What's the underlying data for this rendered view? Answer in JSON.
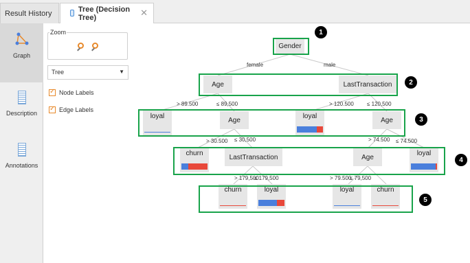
{
  "tabs": {
    "result_history": "Result History",
    "active_tab": "Tree (Decision Tree)",
    "close_glyph": "✕"
  },
  "sidebar": {
    "graph": "Graph",
    "description": "Description",
    "annotations": "Annotations"
  },
  "panel": {
    "zoom_title": "Zoom",
    "view_select": "Tree",
    "node_labels": "Node Labels",
    "edge_labels": "Edge Labels"
  },
  "tree": {
    "root": "Gender",
    "edge_female": "female",
    "edge_male": "male",
    "l1_age": "Age",
    "l1_lasttx": "LastTransaction",
    "e_gt_89500": "> 89.500",
    "e_le_89500": "≤ 89,500",
    "e_gt_120500": "> 120.500",
    "e_le_120500": "≤ 120,500",
    "l2_loyal_a": "loyal",
    "l2_age_a": "Age",
    "l2_loyal_b": "loyal",
    "l2_age_b": "Age",
    "e_gt_30500": "> 30.500",
    "e_le_30500": "≤ 30,500",
    "e_gt_74500": "> 74.500",
    "e_le_74500": "≤ 74.500",
    "l3_churn": "churn",
    "l3_lasttx": "LastTransaction",
    "l3_age": "Age",
    "l3_loyal": "loyal",
    "e_gt_179500": "> 179,500",
    "e_le_179500": "≤ 179,500",
    "e_gt_79500": "> 79.500",
    "e_le_79500": "≤ 79,500",
    "l4_churn_a": "churn",
    "l4_loyal_a": "loyal",
    "l4_loyal_b": "loyal",
    "l4_churn_b": "churn"
  },
  "badges": [
    "1",
    "2",
    "3",
    "4",
    "5"
  ],
  "colors": {
    "blue": "#4a7fdc",
    "red": "#e8483a",
    "highlight": "#18a34a",
    "accent": "#e8892a"
  },
  "leaf_distributions": {
    "l2_loyal_a": {
      "blue": 1.0,
      "red": 0.0,
      "thin": true
    },
    "l2_loyal_b": {
      "blue": 0.75,
      "red": 0.25,
      "thin": false
    },
    "l3_churn": {
      "blue": 0.25,
      "red": 0.75,
      "thin": false
    },
    "l3_loyal": {
      "blue": 0.95,
      "red": 0.05,
      "thin": false
    },
    "l4_churn_a": {
      "blue": 0.0,
      "red": 1.0,
      "thin": true
    },
    "l4_loyal_a": {
      "blue": 0.7,
      "red": 0.3,
      "thin": false
    },
    "l4_loyal_b": {
      "blue": 1.0,
      "red": 0.0,
      "thin": true
    },
    "l4_churn_b": {
      "blue": 0.0,
      "red": 1.0,
      "thin": true
    }
  }
}
